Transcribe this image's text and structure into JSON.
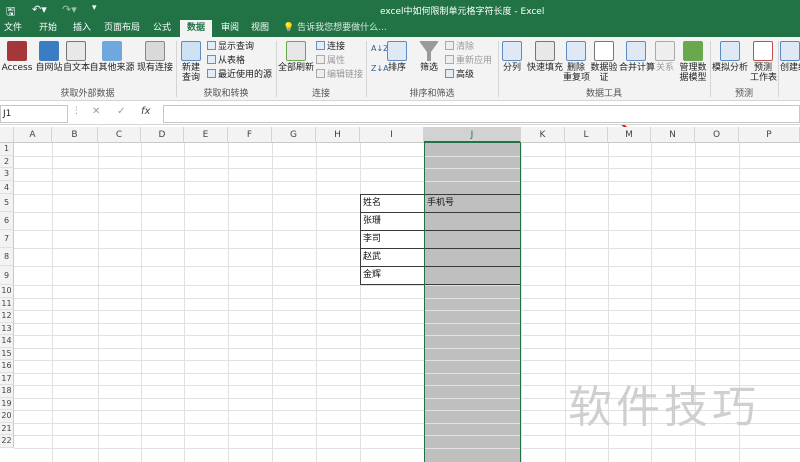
{
  "window": {
    "title": "excel中如何限制单元格字符长度 - Excel"
  },
  "qat": {
    "save_icon": "save-icon",
    "undo_icon": "undo-icon",
    "redo_icon": "redo-icon"
  },
  "tabs": [
    "文件",
    "开始",
    "插入",
    "页面布局",
    "公式",
    "数据",
    "审阅",
    "视图"
  ],
  "active_tab": "数据",
  "tellme": "告诉我您想要做什么...",
  "ribbon": {
    "groups": [
      {
        "label": "获取外部数据",
        "buttons": [
          "Access",
          "自网站",
          "自文本",
          "自其他来源",
          "现有连接"
        ]
      },
      {
        "label": "获取和转换",
        "buttons": [
          "新建查询",
          "显示查询",
          "从表格",
          "最近使用的源"
        ]
      },
      {
        "label": "连接",
        "buttons": [
          "全部刷新",
          "连接",
          "属性",
          "编辑链接"
        ]
      },
      {
        "label": "排序和筛选",
        "buttons": [
          "排序",
          "筛选",
          "清除",
          "重新应用",
          "高级"
        ]
      },
      {
        "label": "数据工具",
        "buttons": [
          "分列",
          "快速填充",
          "删除重复项",
          "数据验证",
          "合并计算",
          "关系",
          "管理数据模型"
        ]
      },
      {
        "label": "预测",
        "buttons": [
          "模拟分析",
          "预测工作表"
        ]
      }
    ],
    "extra": [
      "创建组"
    ],
    "newquery_line1": "新建",
    "newquery_line2": "查询",
    "refresh": "全部刷新",
    "remove_dup_1": "删除",
    "remove_dup_2": "重复项",
    "validate_1": "数据验",
    "validate_2": "证",
    "forecast_1": "预测",
    "forecast_2": "工作表",
    "datamodel_1": "管理数",
    "datamodel_2": "据模型",
    "access_icon": "access-icon"
  },
  "formula_bar": {
    "name_box": "J1",
    "cancel": "✕",
    "enter": "✓",
    "fx": "fx",
    "value": ""
  },
  "sheet": {
    "columns": [
      "A",
      "B",
      "C",
      "D",
      "E",
      "F",
      "G",
      "H",
      "I",
      "J",
      "K",
      "L",
      "M",
      "N",
      "O",
      "P"
    ],
    "selected_column": "J",
    "rows": [
      "1",
      "2",
      "3",
      "4",
      "5",
      "6",
      "7",
      "8",
      "9",
      "10",
      "11",
      "12",
      "13",
      "14",
      "15",
      "16",
      "17",
      "18",
      "19",
      "20",
      "21",
      "22"
    ],
    "cells": {
      "I5": "姓名",
      "J5": "手机号",
      "I6": "张珊",
      "I7": "李司",
      "I8": "赵武",
      "I9": "金辉"
    }
  },
  "watermark": "软件技巧",
  "colors": {
    "excel_green": "#217346",
    "selection_fill": "#bfbfbf",
    "annotation_arrow": "#e0232b"
  }
}
